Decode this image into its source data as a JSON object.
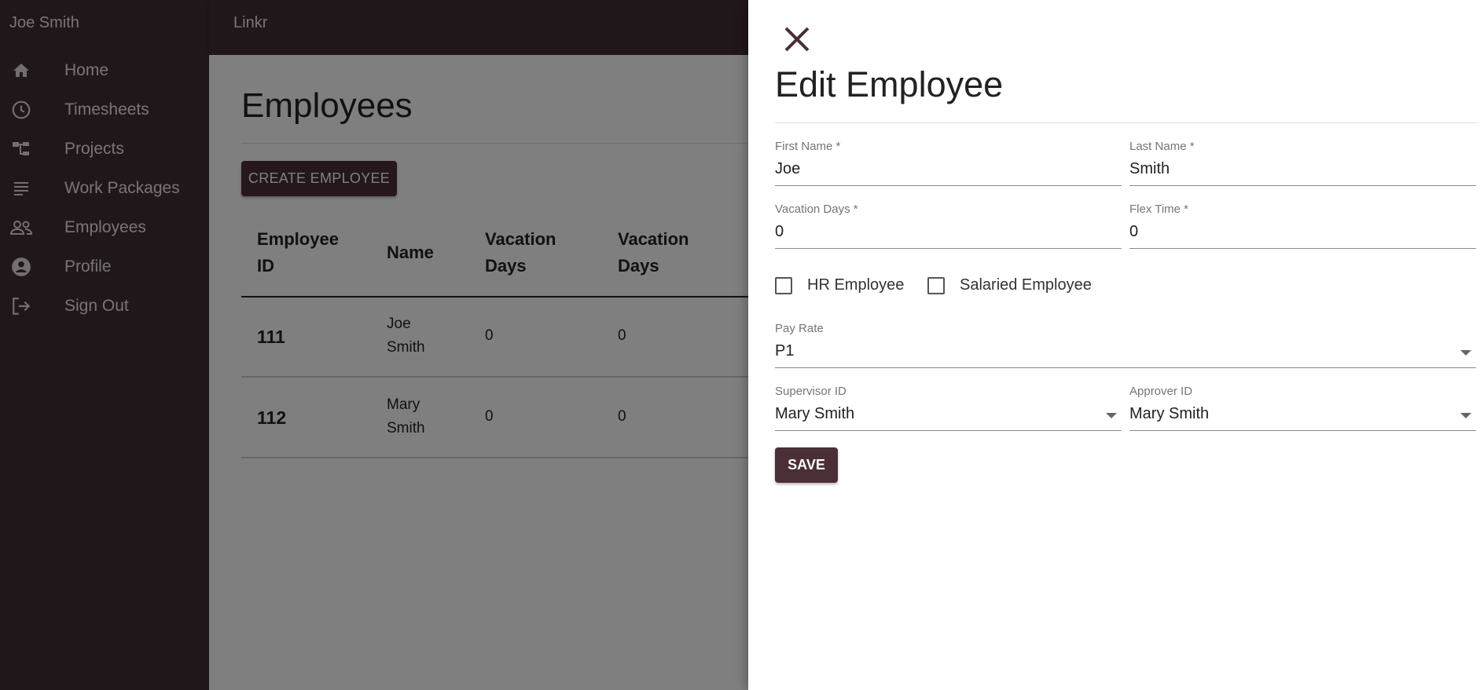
{
  "sidebar": {
    "user_name": "Joe Smith",
    "items": [
      {
        "label": "Home",
        "icon": "home-icon"
      },
      {
        "label": "Timesheets",
        "icon": "clock-icon"
      },
      {
        "label": "Projects",
        "icon": "project-tree-icon"
      },
      {
        "label": "Work Packages",
        "icon": "list-icon"
      },
      {
        "label": "Employees",
        "icon": "people-icon"
      },
      {
        "label": "Profile",
        "icon": "account-circle-icon"
      },
      {
        "label": "Sign Out",
        "icon": "logout-icon"
      }
    ]
  },
  "topbar": {
    "brand": "Linkr"
  },
  "main": {
    "title": "Employees",
    "create_button": "CREATE EMPLOYEE",
    "columns": [
      "Employee\nID",
      "Name",
      "Vacation\nDays",
      "Vacation\nDays"
    ],
    "rows": [
      {
        "id": "111",
        "name": "Joe\nSmith",
        "vacation_1": "0",
        "vacation_2": "0"
      },
      {
        "id": "112",
        "name": "Mary\nSmith",
        "vacation_1": "0",
        "vacation_2": "0"
      }
    ]
  },
  "drawer": {
    "title": "Edit Employee",
    "close_icon": "close-icon",
    "first_name": {
      "label": "First Name *",
      "value": "Joe"
    },
    "last_name": {
      "label": "Last Name *",
      "value": "Smith"
    },
    "vacation_days": {
      "label": "Vacation Days *",
      "value": "0"
    },
    "flex_time": {
      "label": "Flex Time *",
      "value": "0"
    },
    "hr_employee": {
      "label": "HR Employee",
      "checked": false
    },
    "salaried_employee": {
      "label": "Salaried Employee",
      "checked": false
    },
    "pay_rate": {
      "label": "Pay Rate",
      "value": "P1"
    },
    "supervisor_id": {
      "label": "Supervisor ID",
      "value": "Mary Smith"
    },
    "approver_id": {
      "label": "Approver ID",
      "value": "Mary Smith"
    },
    "save_button": "SAVE"
  },
  "colors": {
    "sidebar_bg": "#412e35",
    "accent": "#4a2f37",
    "overlay": "rgba(0,0,0,0.5)"
  }
}
